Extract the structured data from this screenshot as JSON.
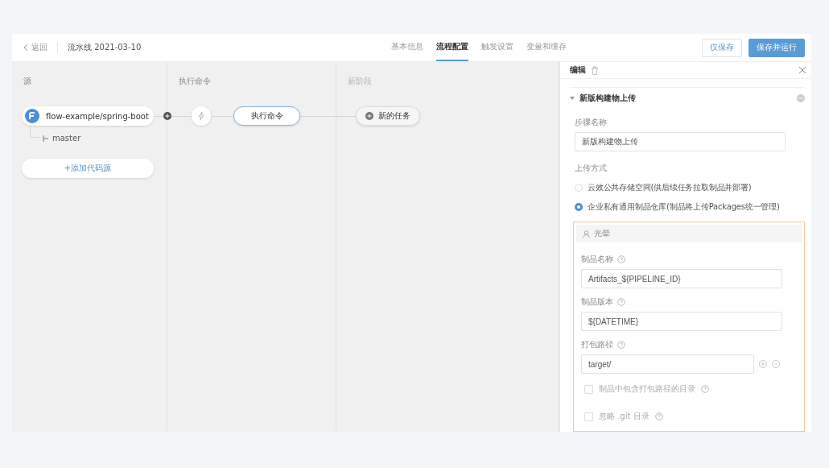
{
  "header": {
    "back": "返回",
    "title": "流水线 2021-03-10",
    "tabs": [
      {
        "label": "基本信息",
        "selected": false
      },
      {
        "label": "流程配置",
        "selected": true
      },
      {
        "label": "触发设置",
        "selected": false
      },
      {
        "label": "变量和缓存",
        "selected": false
      }
    ],
    "buttons": [
      {
        "label": "仅保存",
        "kind": "secondary"
      },
      {
        "label": "保存并运行",
        "kind": "primary"
      }
    ]
  },
  "canvas": {
    "columns": [
      {
        "title": "源",
        "muted": false
      },
      {
        "title": "执行命令",
        "muted": false
      },
      {
        "title": "新阶段",
        "muted": true
      }
    ],
    "source": {
      "repo": "flow-example/spring-boot",
      "branch": "master",
      "add": "+添加代码源"
    },
    "task": "执行命令",
    "new_task": "新的任务"
  },
  "panel": {
    "title": "编辑",
    "section": {
      "title": "新版构建物上传",
      "expanded": true,
      "step_label": "步骤名称",
      "step_value": "新版构建物上传",
      "upload_label": "上传方式",
      "options": [
        {
          "label": "云效公共存储空间(供后续任务拉取制品并部署)",
          "selected": false
        },
        {
          "label": "企业私有通用制品仓库(制品将上传Packages统一管理)",
          "selected": true
        }
      ],
      "repo_box": {
        "title": "光晕",
        "fields": [
          {
            "label": "制品名称",
            "value": "Artifacts_${PIPELINE_ID}",
            "kind": "text"
          },
          {
            "label": "制品版本",
            "value": "${DATETIME}",
            "kind": "text"
          },
          {
            "label": "打包路径",
            "value": "target/",
            "kind": "path"
          }
        ],
        "checks": [
          {
            "label": "制品中包含打包路径的目录",
            "checked": false
          },
          {
            "label": "忽略 .git 目录",
            "checked": false
          }
        ]
      }
    }
  }
}
